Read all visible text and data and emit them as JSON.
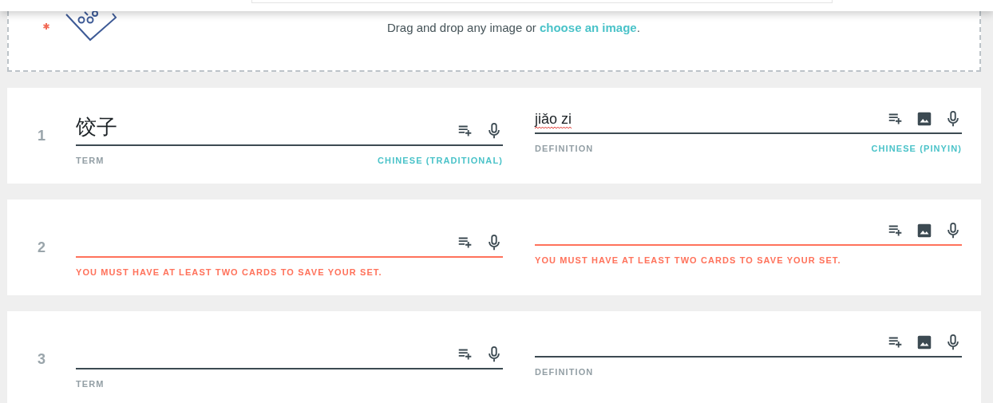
{
  "dropzone": {
    "prompt": "Drag and drop any image or ",
    "link": "choose an image",
    "end": "."
  },
  "cards": [
    {
      "number": "1",
      "term": {
        "value": "饺子",
        "label": "TERM",
        "language": "CHINESE (TRADITIONAL)",
        "error": false
      },
      "definition": {
        "value": "jiǎo zi",
        "label": "DEFINITION",
        "language": "CHINESE (PINYIN)",
        "error": false,
        "misspelled": true
      }
    },
    {
      "number": "2",
      "term": {
        "label": "YOU MUST HAVE AT LEAST TWO CARDS TO SAVE YOUR SET.",
        "error": true
      },
      "definition": {
        "label": "YOU MUST HAVE AT LEAST TWO CARDS TO SAVE YOUR SET.",
        "error": true
      }
    },
    {
      "number": "3",
      "term": {
        "label": "TERM",
        "error": false
      },
      "definition": {
        "label": "DEFINITION",
        "error": false
      }
    }
  ]
}
